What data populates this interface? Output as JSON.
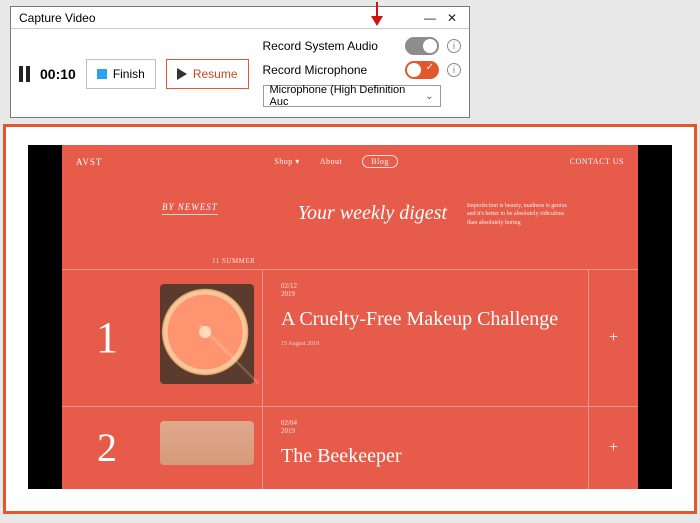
{
  "capture": {
    "title": "Capture Video",
    "timer": "00:10",
    "finish_label": "Finish",
    "resume_label": "Resume",
    "opt_system_audio": "Record System Audio",
    "opt_microphone": "Record Microphone",
    "system_audio_on": false,
    "microphone_on": true,
    "mic_device": "Microphone (High Definition Auc"
  },
  "site": {
    "logo": "AVST",
    "nav": {
      "shop": "Shop ▾",
      "about": "About",
      "blog": "Blog",
      "contact": "CONTACT US"
    },
    "by_newest": "BY NEWEST",
    "digest": "Your weekly digest",
    "blurb": "Imperfection is beauty, madness is genius and it's better to be absolutely ridiculous than absolutely boring",
    "summer_tag": "11 SUMMER",
    "articles": [
      {
        "num": "1",
        "date1": "02/12",
        "date2": "2019",
        "title": "A Cruelty-Free Makeup Challenge",
        "sub": "15 August 2019"
      },
      {
        "num": "2",
        "date1": "02/04",
        "date2": "2019",
        "title": "The Beekeeper"
      }
    ]
  }
}
